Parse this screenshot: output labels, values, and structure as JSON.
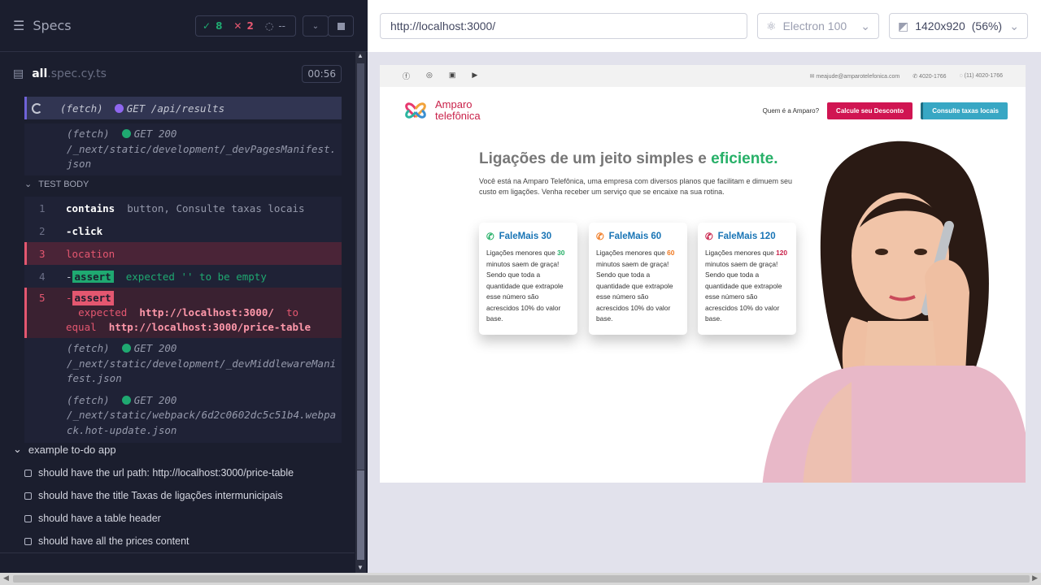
{
  "runner": {
    "title": "Specs",
    "passed": "8",
    "failed": "2",
    "pending": "--",
    "file_name": "all",
    "file_ext": ".spec.cy.ts",
    "timer": "00:56"
  },
  "log": {
    "fetch_pending": {
      "label": "(fetch)",
      "text": "GET /api/results"
    },
    "fetch1": {
      "label": "(fetch)",
      "text": "GET 200",
      "path": "/_next/static/development/_devPagesManifest.json"
    },
    "section": "TEST BODY",
    "cmds": [
      {
        "n": "1",
        "kw": "contains",
        "arg": "button, Consulte taxas locais"
      },
      {
        "n": "2",
        "kw": "-click",
        "arg": ""
      },
      {
        "n": "3",
        "kw": "location",
        "arg": ""
      },
      {
        "n": "4",
        "tag": "assert",
        "text": "expected '' to be empty"
      },
      {
        "n": "5",
        "tag": "assert",
        "expected": "expected",
        "url1": "http://localhost:3000/",
        "to": "to",
        "equal": "equal",
        "url2": "http://localhost:3000/price-table"
      }
    ],
    "fetch2": {
      "label": "(fetch)",
      "text": "GET 200",
      "path": "/_next/static/development/_devMiddlewareManifest.json"
    },
    "fetch3": {
      "label": "(fetch)",
      "text": "GET 200",
      "path": "/_next/static/webpack/6d2c0602dc5c51b4.webpack.hot-update.json"
    }
  },
  "suite": {
    "name": "example to-do app",
    "tests": [
      "should have the url path: http://localhost:3000/price-table",
      "should have the title Taxas de ligações intermunicipais",
      "should have a table header",
      "should have all the prices content"
    ]
  },
  "browser": {
    "url": "http://localhost:3000/",
    "browser": "Electron 100",
    "viewport": "1420x920",
    "zoom": "(56%)"
  },
  "site": {
    "email": "meajude@amparotelefonica.com",
    "phone1": "4020-1766",
    "phone2": "(11) 4020-1766",
    "logo_line1": "Amparo",
    "logo_line2": "telefônica",
    "nav_link": "Quem é a Amparo?",
    "btn_discount": "Calcule seu Desconto",
    "btn_rates": "Consulte taxas locais",
    "hero_title": "Ligações de um jeito simples e",
    "hero_highlight": "eficiente.",
    "hero_text": "Você está na Amparo Telefônica, uma empresa com diversos planos que facilitam e dimuem seu custo em ligações. Venha receber um serviço que se encaixe na sua rotina.",
    "cards": [
      {
        "title": "FaleMais 30",
        "pre": "Ligações menores que",
        "min": "30",
        "post": "minutos saem de graça! Sendo que toda a quantidade que extrapole esse número são acrescidos 10% do valor base.",
        "color": "#27b068"
      },
      {
        "title": "FaleMais 60",
        "pre": "Ligações menores que",
        "min": "60",
        "post": "minutos saem de graça! Sendo que toda a quantidade que extrapole esse número são acrescidos 10% do valor base.",
        "color": "#f07a22"
      },
      {
        "title": "FaleMais 120",
        "pre": "Ligações menores que",
        "min": "120",
        "post": "minutos saem de graça! Sendo que toda a quantidade que extrapole esse número são acrescidos 10% do valor base.",
        "color": "#c9224a"
      }
    ]
  }
}
